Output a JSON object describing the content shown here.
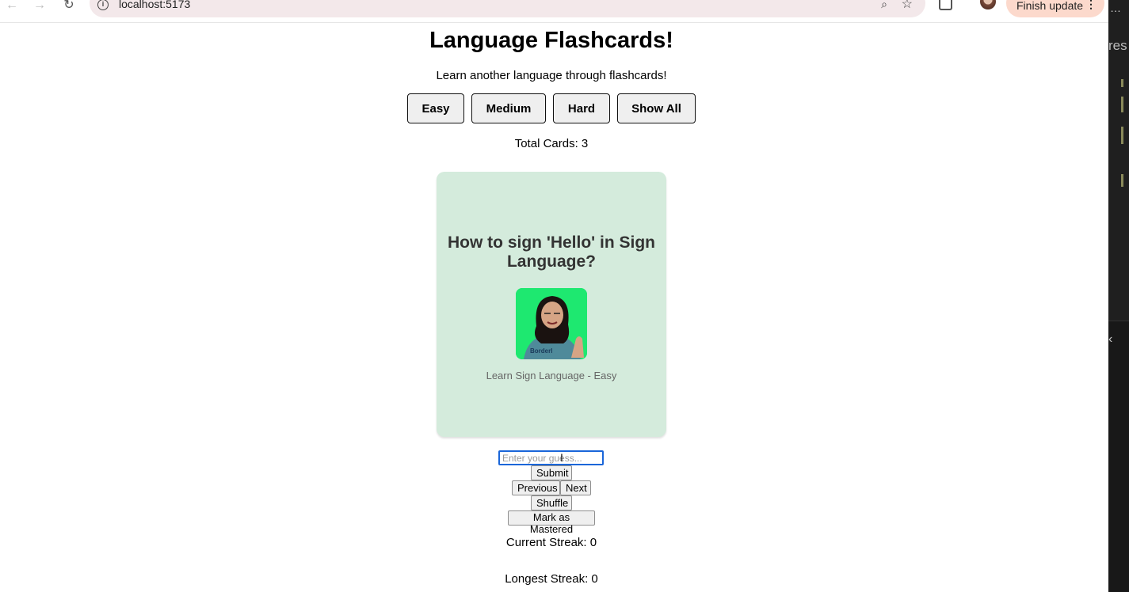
{
  "browser": {
    "url": "localhost:5173",
    "update_label": "Finish update",
    "update_menu": "⋮"
  },
  "side_panel": {
    "partial_text": "res",
    "ellipsis": "…"
  },
  "app": {
    "title": "Language Flashcards!",
    "subtitle": "Learn another language through flashcards!",
    "difficulty_buttons": [
      "Easy",
      "Medium",
      "Hard",
      "Show All"
    ],
    "total_cards": "Total Cards: 3",
    "card": {
      "question": "How to sign 'Hello' in Sign Language?",
      "caption": "Learn Sign Language - Easy",
      "background": "#d4ebdc"
    },
    "guess": {
      "placeholder": "Enter your guess...",
      "value": ""
    },
    "controls": {
      "submit": "Submit",
      "previous": "Previous",
      "next": "Next",
      "shuffle": "Shuffle",
      "mastered": "Mark as Mastered"
    },
    "current_streak": "Current Streak: 0",
    "longest_streak": "Longest Streak: 0"
  }
}
